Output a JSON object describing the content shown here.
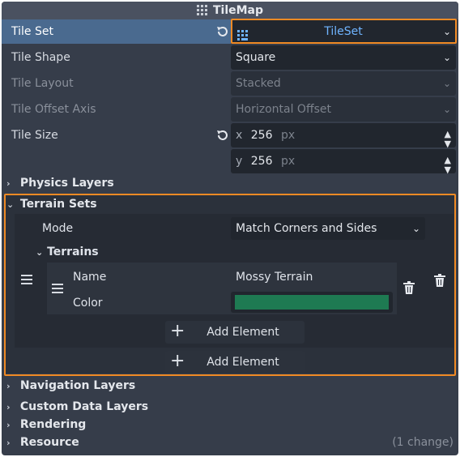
{
  "header": {
    "title": "TileMap"
  },
  "props": {
    "tile_set": {
      "label": "Tile Set",
      "value": "TileSet"
    },
    "tile_shape": {
      "label": "Tile Shape",
      "value": "Square"
    },
    "tile_layout": {
      "label": "Tile Layout",
      "value": "Stacked"
    },
    "tile_offset_axis": {
      "label": "Tile Offset Axis",
      "value": "Horizontal Offset"
    },
    "tile_size": {
      "label": "Tile Size",
      "x_label": "x",
      "x_value": "256",
      "y_label": "y",
      "y_value": "256",
      "unit": "px"
    }
  },
  "sections": {
    "physics_layers": "Physics Layers",
    "terrain_sets": "Terrain Sets",
    "navigation_layers": "Navigation Layers",
    "custom_data_layers": "Custom Data Layers",
    "rendering": "Rendering",
    "resource": "Resource",
    "resource_note": "(1 change)"
  },
  "terrain": {
    "mode_label": "Mode",
    "mode_value": "Match Corners and Sides",
    "terrains_label": "Terrains",
    "name_label": "Name",
    "name_value": "Mossy Terrain",
    "color_label": "Color",
    "color_value": "#1e7a52",
    "add_element_inner": "Add Element",
    "add_element_outer": "Add Element"
  },
  "colors": {
    "highlight": "#f08a24",
    "tileset_text": "#6fb4ff"
  }
}
